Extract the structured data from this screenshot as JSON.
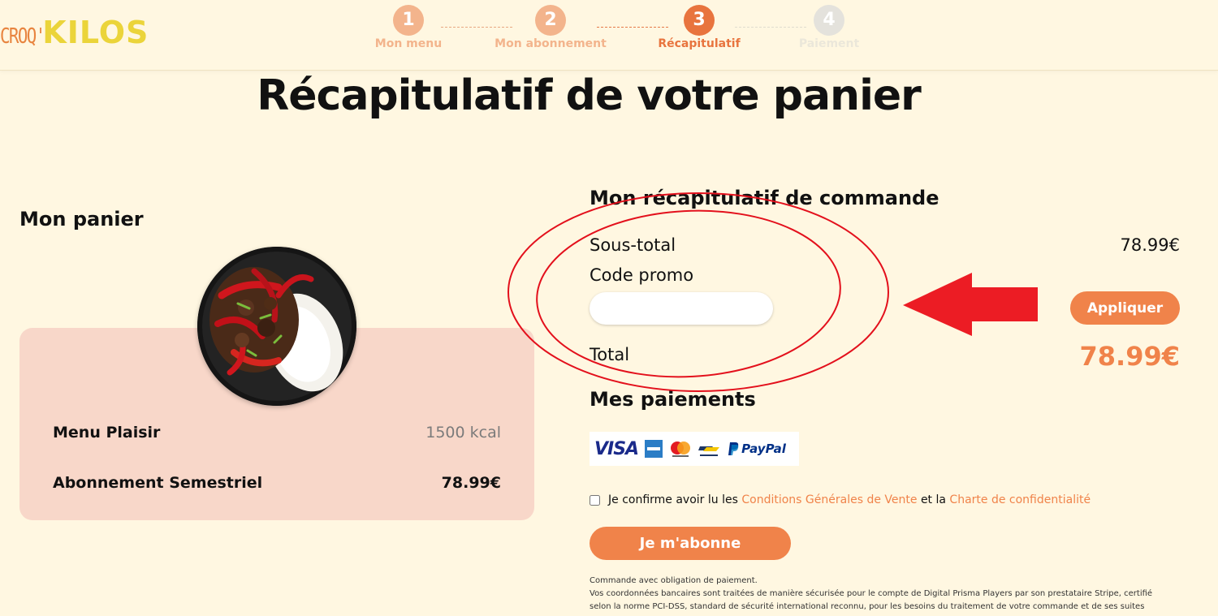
{
  "logo": {
    "part1": "CROQ'",
    "part2": "KILOS"
  },
  "steps": [
    {
      "number": "1",
      "label": "Mon menu",
      "state": "done"
    },
    {
      "number": "2",
      "label": "Mon abonnement",
      "state": "done"
    },
    {
      "number": "3",
      "label": "Récapitulatif",
      "state": "active"
    },
    {
      "number": "4",
      "label": "Paiement",
      "state": "todo"
    }
  ],
  "page_title": "Récapitulatif de votre panier",
  "cart": {
    "heading": "Mon panier",
    "menu_name": "Menu Plaisir",
    "menu_kcal": "1500 kcal",
    "subscription_name": "Abonnement Semestriel",
    "subscription_price": "78.99€"
  },
  "summary": {
    "heading": "Mon récapitulatif de commande",
    "subtotal_label": "Sous-total",
    "subtotal_value": "78.99€",
    "promo_label": "Code promo",
    "promo_value": "",
    "apply_label": "Appliquer",
    "total_label": "Total",
    "total_value": "78.99€"
  },
  "payments": {
    "heading": "Mes paiements",
    "logos": [
      "VISA",
      "American Express",
      "Mastercard",
      "Bancontact",
      "PayPal"
    ],
    "visa_text": "VISA",
    "paypal_text": "PayPal"
  },
  "confirm": {
    "text_before": "Je confirme avoir lu les",
    "cgv_link": "Conditions Générales de Vente",
    "text_middle": "et la",
    "privacy_link": "Charte de confidentialité"
  },
  "subscribe_label": "Je m'abonne",
  "legal": {
    "line1": "Commande avec obligation de paiement.",
    "line2": "Vos coordonnées bancaires sont traitées de manière sécurisée pour le compte de Digital Prisma Players par son prestataire Stripe, certifié selon la norme PCI-DSS, standard de sécurité international reconnu, pour les besoins du traitement de votre commande et de ses suites"
  },
  "colors": {
    "accent": "#f0834a",
    "background": "#fff7e1",
    "card": "#f8d7c9",
    "logo_yellow": "#ebd43a",
    "annotation_red": "#e3101c"
  }
}
